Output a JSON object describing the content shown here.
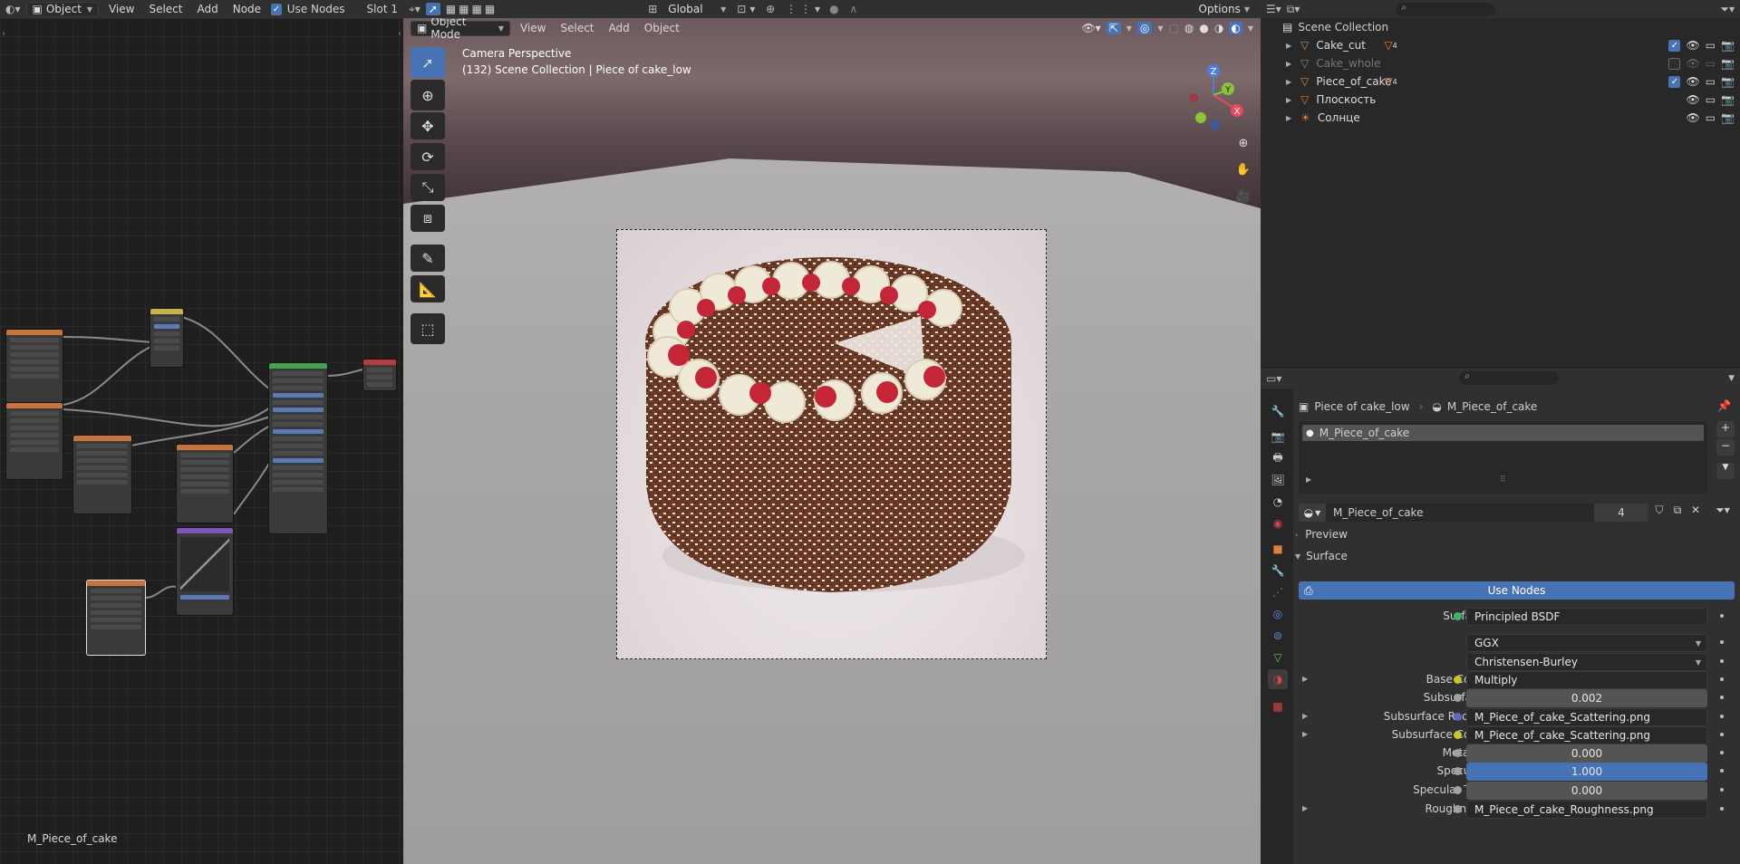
{
  "node_editor": {
    "header": {
      "mode": "Object",
      "menus": [
        "View",
        "Select",
        "Add",
        "Node"
      ],
      "use_nodes_label": "Use Nodes",
      "slot": "Slot 1"
    },
    "material_name": "M_Piece_of_cake"
  },
  "viewport": {
    "header": {
      "mode": "Object Mode",
      "menus": [
        "View",
        "Select",
        "Add",
        "Object"
      ],
      "transform_orientation": "Global",
      "options_label": "Options"
    },
    "camera_title": "Camera Perspective",
    "camera_subtitle": "(132) Scene Collection | Piece of cake_low",
    "gizmo": {
      "z": "Z",
      "y": "Y",
      "x": "X"
    },
    "tools": [
      "select-box-tool",
      "cursor-tool",
      "move-tool",
      "rotate-tool",
      "scale-tool",
      "transform-tool",
      "annotate-tool",
      "measure-tool",
      "add-cube-tool"
    ]
  },
  "outliner": {
    "root": "Scene Collection",
    "items": [
      {
        "name": "Cake_cut",
        "badge": "4",
        "checked": true,
        "dim": false
      },
      {
        "name": "Cake_whole",
        "badge": "",
        "checked": false,
        "dim": true
      },
      {
        "name": "Piece_of_cake",
        "badge": "4",
        "checked": true,
        "dim": false
      },
      {
        "name": "Плоскость",
        "badge": "",
        "checked": null,
        "dim": false
      },
      {
        "name": "Солнце",
        "badge": "",
        "checked": null,
        "dim": false
      }
    ]
  },
  "properties": {
    "breadcrumb_object": "Piece of cake_low",
    "breadcrumb_material": "M_Piece_of_cake",
    "slot_item": "M_Piece_of_cake",
    "material_field": "M_Piece_of_cake",
    "material_users": "4",
    "preview_label": "Preview",
    "surface_label": "Surface",
    "use_nodes_button": "Use Nodes",
    "rows": [
      {
        "label": "Surface",
        "value": "Principled BSDF",
        "kind": "link",
        "dot": "#3fb563"
      },
      {
        "label": "",
        "value": "GGX",
        "kind": "select",
        "dot": ""
      },
      {
        "label": "",
        "value": "Christensen-Burley",
        "kind": "select",
        "dot": ""
      },
      {
        "label": "Base Color",
        "value": "Multiply",
        "kind": "link",
        "dot": "#c7c729",
        "expand": true
      },
      {
        "label": "Subsurface",
        "value": "0.002",
        "kind": "num",
        "dot": "#a1a1a1"
      },
      {
        "label": "Subsurface Radius",
        "value": "M_Piece_of_cake_Scattering.png",
        "kind": "link",
        "dot": "#6363c7",
        "expand": true
      },
      {
        "label": "Subsurface Color",
        "value": "M_Piece_of_cake_Scattering.png",
        "kind": "link",
        "dot": "#c7c729",
        "expand": true
      },
      {
        "label": "Metallic",
        "value": "0.000",
        "kind": "num",
        "dot": "#a1a1a1"
      },
      {
        "label": "Specular",
        "value": "1.000",
        "kind": "blue",
        "dot": "#a1a1a1"
      },
      {
        "label": "Specular Tint",
        "value": "0.000",
        "kind": "num",
        "dot": "#a1a1a1"
      },
      {
        "label": "Roughness",
        "value": "M_Piece_of_cake_Roughness.png",
        "kind": "link",
        "dot": "#a1a1a1",
        "expand": true
      }
    ]
  },
  "colors": {
    "accent": "#4772b3",
    "panel": "#303030",
    "outliner_bg": "#282828"
  }
}
